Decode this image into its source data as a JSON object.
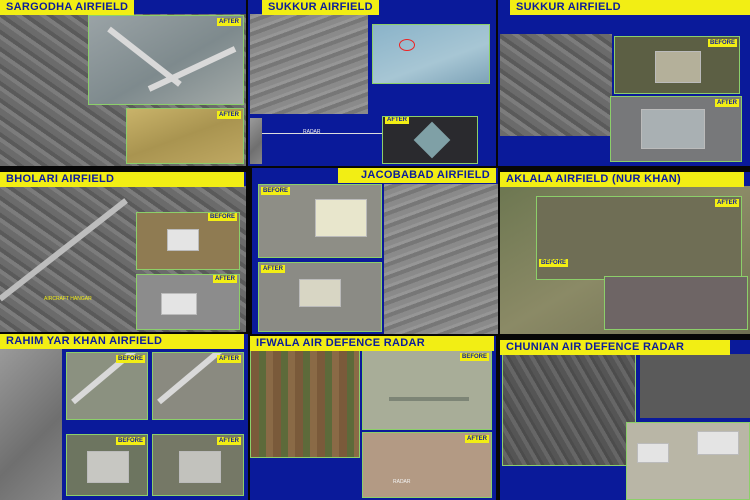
{
  "panels": {
    "sargodha": {
      "title": "SARGODHA AIRFIELD",
      "after1": "AFTER",
      "after2": "AFTER"
    },
    "sukkur1": {
      "title": "SUKKUR AIRFIELD",
      "after": "AFTER",
      "radar": "RADAR"
    },
    "sukkur2": {
      "title": "SUKKUR AIRFIELD",
      "before": "BEFORE",
      "after": "AFTER"
    },
    "bholari": {
      "title": "BHOLARI AIRFIELD",
      "before": "BEFORE",
      "after": "AFTER",
      "hangar": "AIRCRAFT HANGAR"
    },
    "jacobabad": {
      "title": "JACOBABAD AIRFIELD",
      "before": "BEFORE",
      "after": "AFTER"
    },
    "nurkhan": {
      "title": "AKLALA AIRFIELD (NUR KHAN)",
      "before": "BEFORE",
      "after": "AFTER"
    },
    "rahimyarkhan": {
      "title": "RAHIM YAR KHAN AIRFIELD",
      "before1": "BEFORE",
      "after1": "AFTER",
      "before2": "BEFORE",
      "after2": "AFTER"
    },
    "ifwala": {
      "title": "IFWALA AIR DEFENCE RADAR",
      "before": "BEFORE",
      "after": "AFTER",
      "radar": "RADAR"
    },
    "chunian": {
      "title": "CHUNIAN AIR DEFENCE RADAR"
    }
  }
}
